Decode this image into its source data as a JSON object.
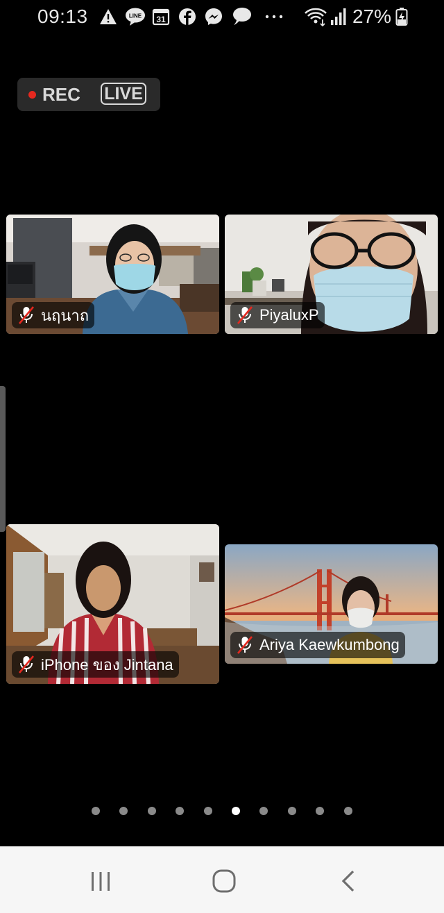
{
  "status_bar": {
    "time": "09:13",
    "battery": "27%",
    "icons": [
      "alert-icon",
      "line-app-icon",
      "calendar-icon",
      "facebook-icon",
      "messenger-icon",
      "chat-bubble-icon",
      "more-dots-icon",
      "wifi-icon",
      "signal-icon",
      "battery-charging-icon"
    ],
    "calendar_day": "31",
    "line_label": "LINE"
  },
  "recording": {
    "rec_label": "REC",
    "live_label": "LIVE",
    "rec_color": "#e5281f"
  },
  "participants": [
    {
      "name": "นฤนาถ",
      "muted": true
    },
    {
      "name": "PiyaluxP",
      "muted": true
    },
    {
      "name": "iPhone ของ Jintana",
      "muted": true
    },
    {
      "name": "Ariya Kaewkumbong",
      "muted": true
    }
  ],
  "pagination": {
    "count": 10,
    "active_index": 5
  },
  "nav": {
    "buttons": [
      "recent-apps-icon",
      "home-icon",
      "back-icon"
    ],
    "background": "#f6f6f6"
  }
}
